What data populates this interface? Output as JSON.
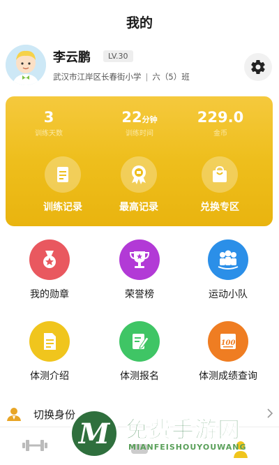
{
  "page": {
    "title": "我的"
  },
  "profile": {
    "name": "李云鹏",
    "level": "LV.30",
    "school": "武汉市江岸区长春街小学",
    "divider": "|",
    "class": "六（5）班"
  },
  "stats": [
    {
      "value": "3",
      "unit": "",
      "label": "训练天数"
    },
    {
      "value": "22",
      "unit": "分钟",
      "label": "训练时间"
    },
    {
      "value": "229.0",
      "unit": "",
      "label": "金币"
    }
  ],
  "features": [
    {
      "label": "训练记录",
      "icon": "document-icon"
    },
    {
      "label": "最高记录",
      "icon": "award-icon"
    },
    {
      "label": "兑换专区",
      "icon": "shopping-bag-icon"
    }
  ],
  "grid": [
    {
      "label": "我的勋章",
      "icon": "medal-icon",
      "color": "#e9585f"
    },
    {
      "label": "荣誉榜",
      "icon": "trophy-icon",
      "color": "#b23ad6"
    },
    {
      "label": "运动小队",
      "icon": "team-icon",
      "color": "#2b8fe8"
    },
    {
      "label": "体测介绍",
      "icon": "document-icon",
      "color": "#f0c51d"
    },
    {
      "label": "体测报名",
      "icon": "edit-icon",
      "color": "#3fc565"
    },
    {
      "label": "体测成绩查询",
      "icon": "score-100-icon",
      "color": "#ef7d22"
    }
  ],
  "switch": {
    "label": "切换身份"
  },
  "colors": {
    "card": "#eebe1c",
    "accent": "#f5c93d"
  },
  "watermark": {
    "letter": "M",
    "title": "免费手游网",
    "subtitle": "MIANFEISHOUYOUWANG"
  }
}
